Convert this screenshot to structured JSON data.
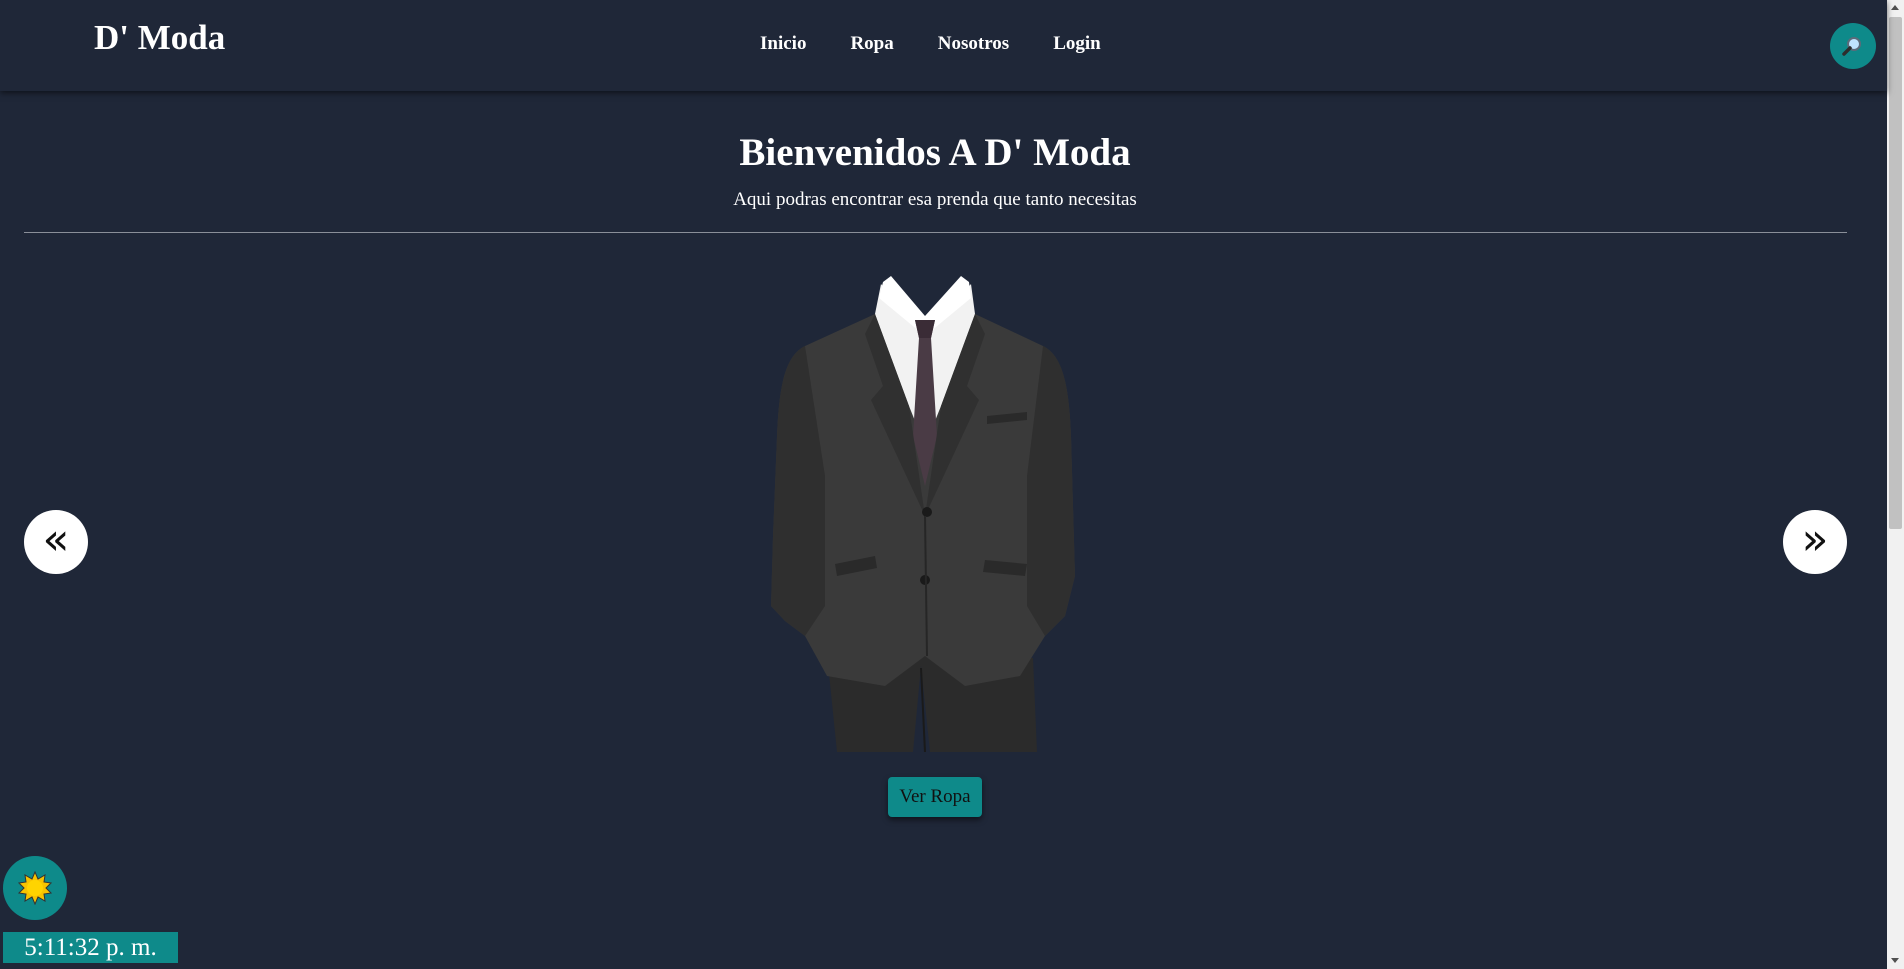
{
  "header": {
    "brand": "D' Moda",
    "nav": [
      "Inicio",
      "Ropa",
      "Nosotros",
      "Login"
    ],
    "search_icon": "search-icon"
  },
  "hero": {
    "title": "Bienvenidos A D' Moda",
    "subtitle": "Aqui podras encontrar esa prenda que tanto necesitas"
  },
  "carousel": {
    "prev_label": "«",
    "next_label": "»",
    "slide_image": "suit-image"
  },
  "cta": {
    "label": "Ver Ropa"
  },
  "theme_toggle": {
    "icon": "sun-icon"
  },
  "clock": {
    "time": "5:11:32 p. m."
  },
  "colors": {
    "background": "#1f2738",
    "accent": "#0e8a8a",
    "text": "#ffffff"
  }
}
